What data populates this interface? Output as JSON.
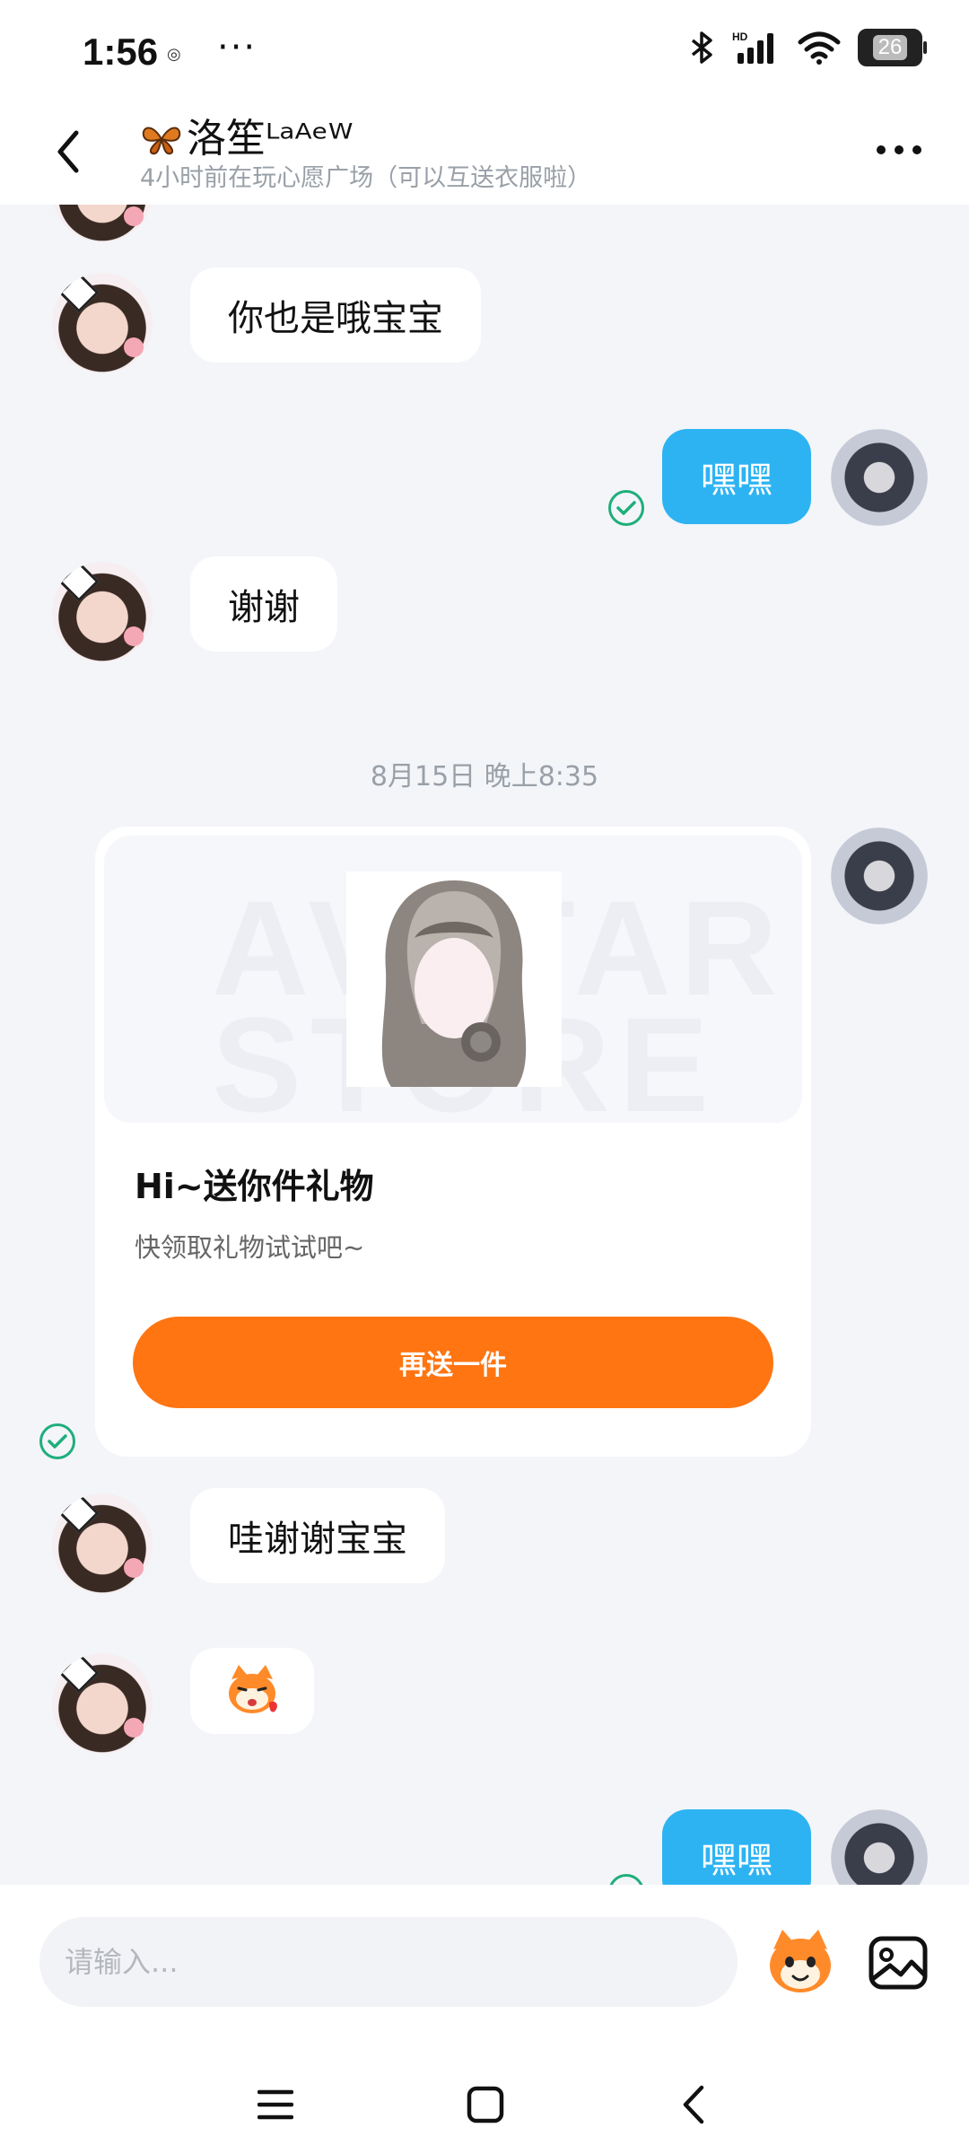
{
  "status_bar": {
    "time": "1:56",
    "more": "···",
    "battery_level": "26"
  },
  "header": {
    "contact_name": "洛笙ᴸᵃᴬᵉᵂ",
    "status_text": "4小时前在玩心愿广场（可以互送衣服啦）"
  },
  "messages": [
    {
      "side": "left",
      "text": "你也是哦宝宝"
    },
    {
      "side": "right",
      "text": "嘿嘿",
      "read": true
    },
    {
      "side": "left",
      "text": "谢谢"
    },
    {
      "type": "timestamp",
      "text": "8月15日 晚上8:35"
    },
    {
      "side": "right",
      "type": "gift_card",
      "title": "Hi~送你件礼物",
      "subtitle": "快领取礼物试试吧~",
      "button": "再送一件",
      "watermark": "AVATAR STORE"
    },
    {
      "side": "left",
      "text": "哇谢谢宝宝"
    },
    {
      "side": "left",
      "type": "sticker",
      "icon": "cat-sticker-icon"
    },
    {
      "side": "right",
      "text": "嘿嘿",
      "read": true
    }
  ],
  "input": {
    "placeholder": "请输入..."
  },
  "colors": {
    "accent_blue": "#2db3f2",
    "accent_orange": "#ff7512",
    "read_green": "#1fae7a",
    "background": "#f3f5f9"
  },
  "icons": {
    "back": "chevron-left-icon",
    "more": "more-horizontal-icon",
    "emoji": "cat-emoji-icon",
    "gallery": "image-icon",
    "nav_menu": "menu-icon",
    "nav_home": "square-icon",
    "nav_back": "chevron-left-icon"
  }
}
